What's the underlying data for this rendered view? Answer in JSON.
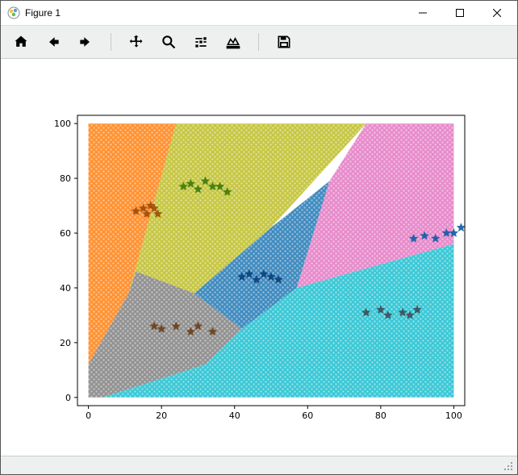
{
  "window": {
    "title": "Figure 1"
  },
  "toolbar": {
    "home": "Home",
    "back": "Back",
    "forward": "Forward",
    "pan": "Pan",
    "zoom": "Zoom",
    "configure": "Configure subplots",
    "edit": "Edit axis",
    "save": "Save"
  },
  "axes": {
    "x_ticks": [
      "0",
      "20",
      "40",
      "60",
      "80",
      "100"
    ],
    "y_ticks": [
      "0",
      "20",
      "40",
      "60",
      "80",
      "100"
    ],
    "xlim": [
      -3,
      103
    ],
    "ylim": [
      -3,
      103
    ]
  },
  "chart_data": {
    "type": "scatter",
    "title": "",
    "xlabel": "",
    "ylabel": "",
    "xlim": [
      0,
      100
    ],
    "ylim": [
      0,
      100
    ],
    "regions": [
      {
        "name": "orange",
        "color": "#ff7f0e",
        "polygon": [
          [
            0,
            100
          ],
          [
            24,
            100
          ],
          [
            11,
            38
          ],
          [
            0,
            12
          ]
        ]
      },
      {
        "name": "olive",
        "color": "#bcbd22",
        "polygon": [
          [
            24,
            100
          ],
          [
            76,
            100
          ],
          [
            50,
            62
          ],
          [
            29,
            38
          ],
          [
            13,
            46
          ],
          [
            11,
            38
          ]
        ]
      },
      {
        "name": "brown",
        "color": "#8c564b",
        "polygon": [
          [
            11,
            38
          ],
          [
            0,
            12
          ],
          [
            0,
            0
          ],
          [
            4,
            0
          ],
          [
            13,
            46
          ]
        ],
        "hidden": true
      },
      {
        "name": "gray",
        "color": "#7f7f7f",
        "polygon": [
          [
            13,
            46
          ],
          [
            29,
            38
          ],
          [
            42,
            25
          ],
          [
            32,
            12
          ],
          [
            4,
            0
          ],
          [
            0,
            0
          ],
          [
            0,
            12
          ],
          [
            11,
            38
          ]
        ]
      },
      {
        "name": "blue",
        "color": "#1f77b4",
        "polygon": [
          [
            29,
            38
          ],
          [
            50,
            62
          ],
          [
            76,
            100
          ],
          [
            77,
            100
          ],
          [
            56,
            50
          ],
          [
            42,
            25
          ]
        ],
        "hidden": true
      },
      {
        "name": "blue_wedge",
        "color": "#1f77b4",
        "polygon": [
          [
            29,
            38
          ],
          [
            50,
            62
          ],
          [
            66,
            79
          ],
          [
            57,
            40
          ],
          [
            42,
            25
          ]
        ]
      },
      {
        "name": "pink",
        "color": "#e377c2",
        "polygon": [
          [
            66,
            79
          ],
          [
            76,
            100
          ],
          [
            100,
            100
          ],
          [
            100,
            56
          ],
          [
            57,
            40
          ]
        ]
      },
      {
        "name": "cyan",
        "color": "#17becf",
        "polygon": [
          [
            57,
            40
          ],
          [
            100,
            56
          ],
          [
            100,
            0
          ],
          [
            4,
            0
          ],
          [
            32,
            12
          ],
          [
            42,
            25
          ]
        ]
      }
    ],
    "clusters": [
      {
        "name": "orange-stars",
        "color": "#9c4b09",
        "points": [
          [
            13,
            68
          ],
          [
            15,
            69
          ],
          [
            16,
            67
          ],
          [
            17,
            70
          ],
          [
            18,
            69
          ],
          [
            19,
            67
          ]
        ]
      },
      {
        "name": "olive-stars",
        "color": "#3b7a0b",
        "points": [
          [
            26,
            77
          ],
          [
            28,
            78
          ],
          [
            30,
            76
          ],
          [
            32,
            79
          ],
          [
            34,
            77
          ],
          [
            36,
            77
          ],
          [
            38,
            75
          ]
        ]
      },
      {
        "name": "blue-stars",
        "color": "#0b3e7a",
        "points": [
          [
            42,
            44
          ],
          [
            44,
            45
          ],
          [
            46,
            43
          ],
          [
            48,
            45
          ],
          [
            50,
            44
          ],
          [
            52,
            43
          ]
        ]
      },
      {
        "name": "gray-stars",
        "color": "#6b3e18",
        "points": [
          [
            18,
            26
          ],
          [
            20,
            25
          ],
          [
            24,
            26
          ],
          [
            28,
            24
          ],
          [
            30,
            26
          ],
          [
            34,
            24
          ]
        ]
      },
      {
        "name": "cyan-stars",
        "color": "#3f4b55",
        "points": [
          [
            76,
            31
          ],
          [
            80,
            32
          ],
          [
            82,
            30
          ],
          [
            86,
            31
          ],
          [
            88,
            30
          ],
          [
            90,
            32
          ]
        ]
      },
      {
        "name": "pink-stars",
        "color": "#0d5aa6",
        "points": [
          [
            89,
            58
          ],
          [
            92,
            59
          ],
          [
            95,
            58
          ],
          [
            98,
            60
          ],
          [
            100,
            60
          ],
          [
            102,
            62
          ]
        ]
      }
    ]
  }
}
